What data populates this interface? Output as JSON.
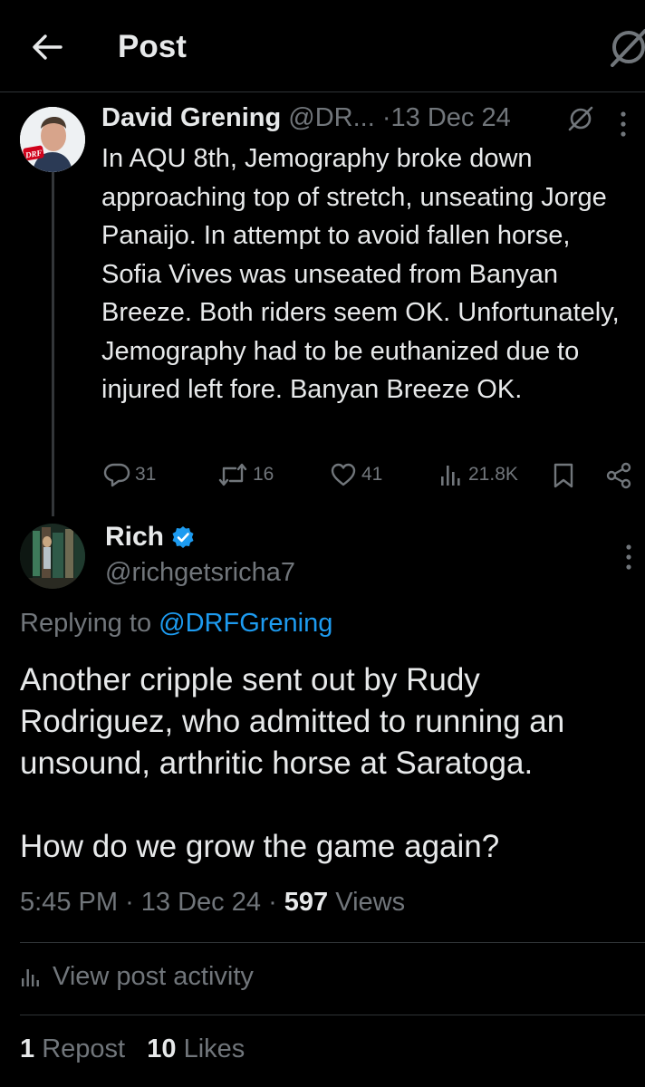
{
  "header": {
    "title": "Post"
  },
  "parent_post": {
    "author_name": "David Grening",
    "author_handle": "@DR...",
    "separator": "·",
    "date": "13 Dec 24",
    "avatar_logo_text": "DRF",
    "text": "In AQU 8th, Jemography broke down approaching top of stretch, unseating Jorge Panaijo. In attempt to avoid fallen horse, Sofia Vives was unseated from Banyan Breeze. Both riders seem OK. Unfortunately, Jemography had to be euthanized due to injured left fore. Banyan Breeze OK.",
    "actions": {
      "replies": "31",
      "reposts": "16",
      "likes": "41",
      "views": "21.8K"
    }
  },
  "reply_post": {
    "author_name": "Rich",
    "author_handle": "@richgetsricha7",
    "verified": true,
    "replying_prefix": "Replying to",
    "replying_to": "@DRFGrening",
    "text_paragraph_1": "Another cripple sent out by Rudy Rodriguez, who admitted to running an unsound, arthritic horse at Saratoga.",
    "text_paragraph_2": "How do we grow the game again?",
    "time": "5:45 PM",
    "date": "13 Dec 24",
    "separator": "·",
    "views_count": "597",
    "views_label": "Views"
  },
  "activity": {
    "label": "View post activity"
  },
  "stats": {
    "reposts_count": "1",
    "reposts_label": "Repost",
    "likes_count": "10",
    "likes_label": "Likes"
  },
  "colors": {
    "background": "#000000",
    "text_primary": "#e7e9ea",
    "text_secondary": "#71767b",
    "accent": "#1d9bf0",
    "divider": "#2f3336"
  }
}
